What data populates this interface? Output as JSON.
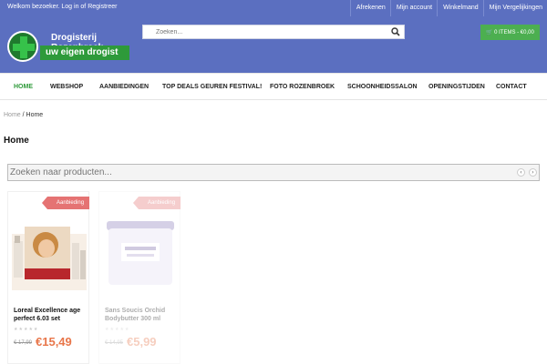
{
  "topbar": {
    "welcome": "Welkom bezoeker. Log in of Registreer",
    "links": [
      "Afrekenen",
      "Mijn account",
      "Winkelmand",
      "Mijn Vergelijkingen"
    ]
  },
  "logo": {
    "name_line1": "Drogisterij",
    "name_line2": "Rozenbroek",
    "tagline": "uw eigen drogist"
  },
  "search": {
    "placeholder": "Zoeken...",
    "icon": "search-icon"
  },
  "cart": {
    "label": "🛒 0 ITEMS - €0,00",
    "icon": "cart-icon"
  },
  "nav": {
    "items": [
      "HOME",
      "WEBSHOP",
      "AANBIEDINGEN",
      "TOP DEALS GEUREN FESTIVAL!",
      "FOTO ROZENBROEK",
      "SCHOONHEIDSSALON",
      "OPENINGSTIJDEN",
      "CONTACT"
    ],
    "active": "HOME"
  },
  "breadcrumb": {
    "home": "Home",
    "separator": " / ",
    "current": "Home"
  },
  "page": {
    "title": "Home"
  },
  "product_search": {
    "placeholder": "Zoeken naar producten...",
    "prev": "‹",
    "next": "›"
  },
  "products": [
    {
      "badge": "Aanbieding",
      "name": "Loreal Excellence age perfect 6.03 set",
      "old_price": "€ 17,99",
      "new_price": "€15,49",
      "rating": "★★★★★"
    },
    {
      "badge": "Aanbieding",
      "name": "Sans Soucis Orchid Bodybutter 300 ml",
      "old_price": "€ 14,95",
      "new_price": "€5,99",
      "rating": "★★★★★"
    }
  ],
  "colors": {
    "header_bg": "#5b6fc0",
    "accent_green": "#4caf50",
    "badge": "#e57373",
    "price": "#e8764a"
  }
}
